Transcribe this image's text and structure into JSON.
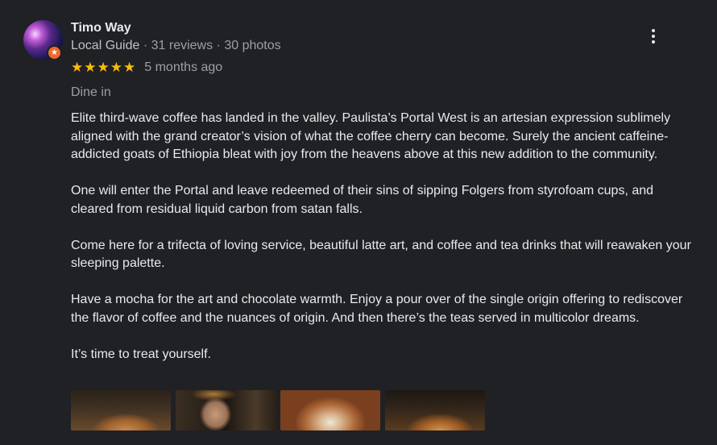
{
  "reviewer": {
    "name": "Timo Way",
    "level": "Local Guide",
    "separator": "·",
    "reviews": "31 reviews",
    "photos": "30 photos"
  },
  "rating": {
    "stars": 5,
    "star_glyph": "★",
    "age": "5 months ago"
  },
  "tag": "Dine in",
  "body": [
    "Elite third-wave coffee has landed in the valley. Paulista’s Portal West is an artesian expression sublimely aligned with the grand creator’s vision of what the coffee cherry can become. Surely the ancient caffeine-addicted goats of Ethiopia bleat with joy from the heavens above at this new addition to the community.",
    "One will enter the Portal and leave redeemed of their sins of sipping Folgers from styrofoam cups, and cleared from residual liquid carbon from satan falls.",
    "Come here for a trifecta of loving service, beautiful latte art, and coffee and tea drinks that will reawaken your sleeping palette.",
    "Have a mocha for the art and chocolate warmth. Enjoy a pour over of the single origin offering to rediscover the flavor of coffee and the nuances of origin. And then there’s the teas served in multicolor dreams.",
    "It’s time to treat yourself."
  ],
  "icons": {
    "more": "more-vert-icon",
    "badge": "local-guide-star-icon"
  },
  "colors": {
    "background": "#202124",
    "star": "#fbbc04",
    "badge": "#ee6a2c",
    "text": "#e8eaed",
    "muted": "#9aa0a6"
  }
}
